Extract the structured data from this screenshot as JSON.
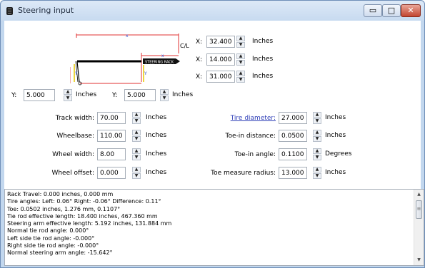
{
  "window": {
    "title": "Steering input",
    "min_glyph": "▭",
    "max_glyph": "□",
    "close_glyph": "✕"
  },
  "diagram": {
    "cl_label": "C/L",
    "rack_label": "STEERING RACK",
    "y_mark": "Y",
    "x_mark": "x"
  },
  "rack_fields": [
    {
      "label": "X:",
      "value": "32.400",
      "unit": "Inches"
    },
    {
      "label": "X:",
      "value": "14.000",
      "unit": "Inches"
    },
    {
      "label": "X:",
      "value": "31.000",
      "unit": "Inches"
    }
  ],
  "y_fields": [
    {
      "label": "Y:",
      "value": "5.000",
      "unit": "Inches"
    },
    {
      "label": "Y:",
      "value": "5.000",
      "unit": "Inches"
    }
  ],
  "left_fields": [
    {
      "label": "Track width:",
      "value": "70.00",
      "unit": "Inches"
    },
    {
      "label": "Wheelbase:",
      "value": "110.00",
      "unit": "Inches"
    },
    {
      "label": "Wheel width:",
      "value": "8.00",
      "unit": "Inches"
    },
    {
      "label": "Wheel offset:",
      "value": "0.000",
      "unit": "Inches"
    }
  ],
  "right_fields": [
    {
      "label": "Tire diameter:",
      "value": "27.000",
      "unit": "Inches"
    },
    {
      "label": "Toe-in distance:",
      "value": "0.0500",
      "unit": "Inches"
    },
    {
      "label": "Toe-in angle:",
      "value": "0.1100",
      "unit": "Degrees"
    },
    {
      "label": "Toe measure radius:",
      "value": "13.000",
      "unit": "Inches"
    }
  ],
  "output_lines": [
    "Rack Travel: 0.000 inches, 0.000 mm",
    "Tire angles: Left: 0.06° Right: -0.06° Difference: 0.11°",
    "Toe: 0.0502 inches, 1.276 mm, 0.1107°",
    "Tie rod effective length: 18.400 inches, 467.360 mm",
    "Steering arm effective length: 5.192 inches, 131.884 mm",
    "Normal tie rod angle: 0.000°",
    "Left side tie rod angle: -0.000°",
    "Right side tie rod angle: -0.000°",
    "Normal steering arm angle: -15.642°"
  ],
  "spinner_glyphs": {
    "up": "▲",
    "down": "▼"
  },
  "scroll_glyphs": {
    "up": "▲",
    "down": "▼",
    "grip": "≡"
  },
  "colors": {
    "link": "#2f3fb8",
    "dim_red": "#e03030",
    "dim_yellow": "#e8c800",
    "accent": "#c7daf0"
  }
}
